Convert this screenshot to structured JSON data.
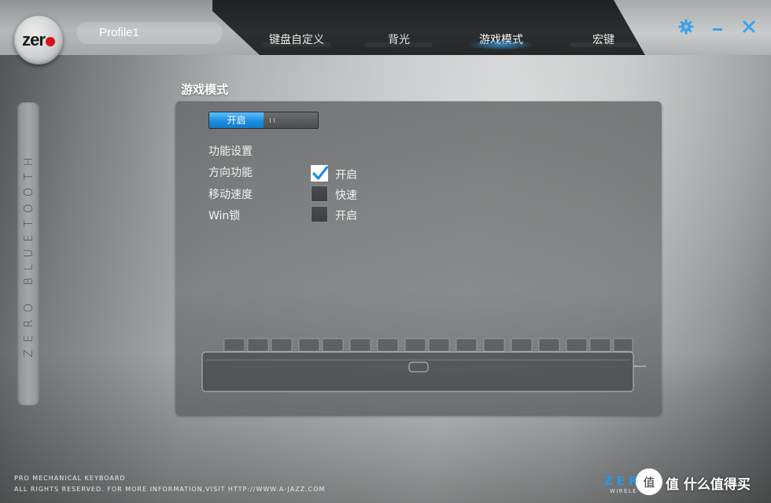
{
  "window": {
    "logo_text": "zer",
    "profile_name": "Profile1",
    "tabs": [
      {
        "label": "键盘自定义",
        "active": false
      },
      {
        "label": "背光",
        "active": false
      },
      {
        "label": "游戏模式",
        "active": true
      },
      {
        "label": "宏键",
        "active": false
      }
    ],
    "controls": {
      "settings_icon": "gear-icon",
      "minimize_icon": "minimize-icon",
      "close_icon": "close-icon"
    },
    "accent_color": "#2a98e0"
  },
  "sidebar": {
    "text": "ZERO BLUETOOTH"
  },
  "main": {
    "section_title": "游戏模式",
    "master_toggle": {
      "on_label": "开启",
      "state": "on"
    },
    "settings_heading": "功能设置",
    "options": [
      {
        "label": "方向功能",
        "checkbox_label": "开启",
        "checked": true
      },
      {
        "label": "移动速度",
        "checkbox_label": "快速",
        "checked": false
      },
      {
        "label": "Win锁",
        "checkbox_label": "开启",
        "checked": false
      }
    ]
  },
  "footer": {
    "line1": "PRO MECHANICAL KEYBOARD",
    "line2": "ALL RIGHTS RESERVED. FOR MORE INFORMATION,VISIT HTTP://WWW.A-JAZZ.COM",
    "brand": "ZER",
    "brand_sub": "WIRELE",
    "watermark": "值 什么值得买"
  }
}
